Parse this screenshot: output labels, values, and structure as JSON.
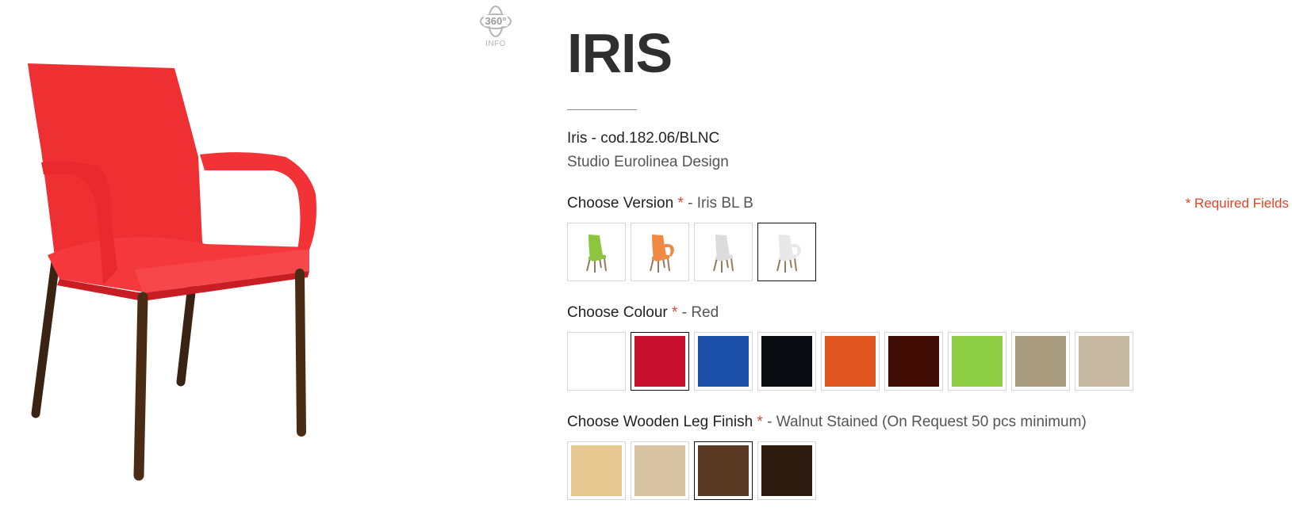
{
  "product": {
    "title": "IRIS",
    "code": "Iris - cod.182.06/BLNC",
    "designer": "Studio Eurolinea Design",
    "image_icon": "red-armchair-image"
  },
  "view360": {
    "icon": "360-rotate-icon",
    "top_text": "360°",
    "label": "INFO"
  },
  "required_fields": "* Required Fields",
  "options": {
    "version": {
      "label": "Choose Version",
      "star": "*",
      "selected": " - Iris BL B",
      "items": [
        {
          "name": "green-chair",
          "color": "#8cc63f",
          "icon": "chair-icon"
        },
        {
          "name": "orange-chair-arms",
          "color": "#f08a43",
          "icon": "armchair-icon"
        },
        {
          "name": "white-chair",
          "color": "#dcdcdc",
          "icon": "chair-icon"
        },
        {
          "name": "white-chair-arms",
          "color": "#e8e8e8",
          "icon": "armchair-icon",
          "selected": true
        }
      ]
    },
    "colour": {
      "label": "Choose Colour",
      "star": "*",
      "selected": " - Red",
      "items": [
        {
          "name": "white",
          "color": "#ffffff"
        },
        {
          "name": "red",
          "color": "#c8102e",
          "selected": true
        },
        {
          "name": "blue",
          "color": "#1c4fa8"
        },
        {
          "name": "black",
          "color": "#0b0b12"
        },
        {
          "name": "orange",
          "color": "#e15521"
        },
        {
          "name": "bordeaux",
          "color": "#3f0b03"
        },
        {
          "name": "lime",
          "color": "#8dce44"
        },
        {
          "name": "taupe",
          "color": "#a89b7e"
        },
        {
          "name": "sand",
          "color": "#c6b8a1"
        }
      ]
    },
    "leg": {
      "label": "Choose Wooden Leg Finish",
      "star": "*",
      "selected": " - Walnut Stained (On Request 50 pcs minimum)",
      "items": [
        {
          "name": "natural-beech",
          "color": "#e8c891"
        },
        {
          "name": "bleached-oak",
          "color": "#d8c4a3"
        },
        {
          "name": "walnut-stained",
          "color": "#5a3a22",
          "selected": true
        },
        {
          "name": "wenge",
          "color": "#2c1a0f"
        }
      ]
    }
  }
}
